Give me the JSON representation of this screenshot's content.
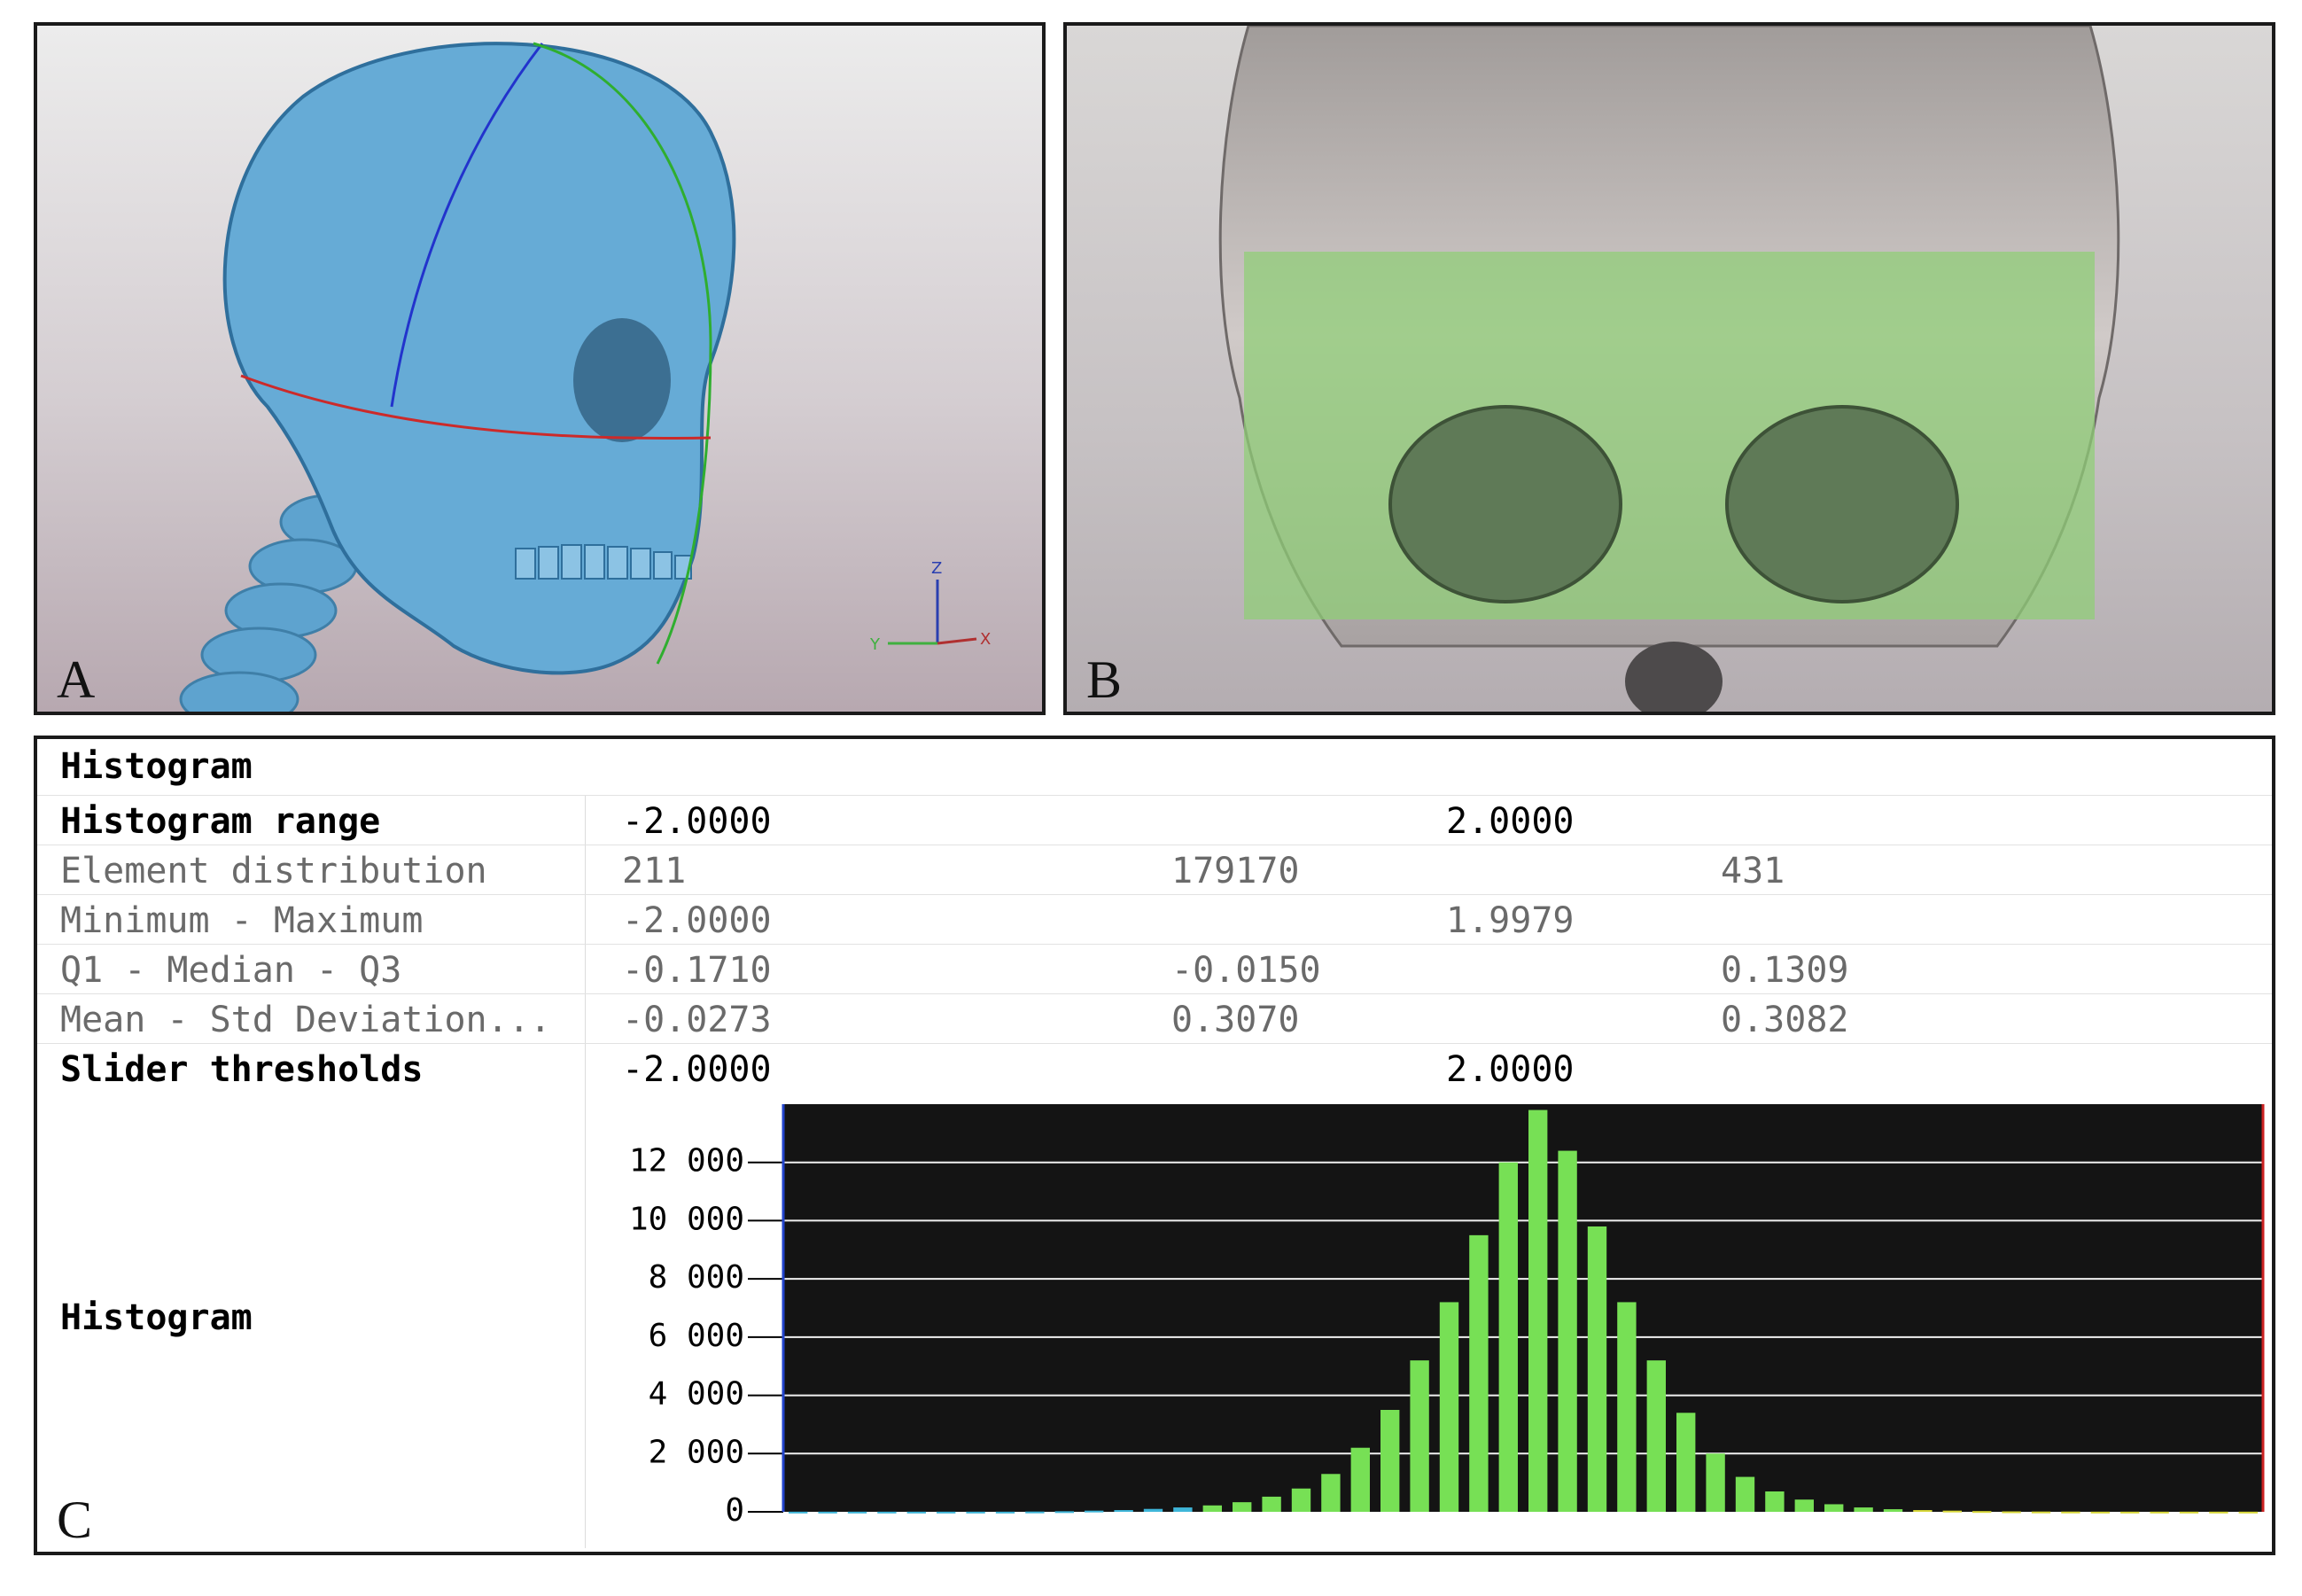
{
  "panels": {
    "a": {
      "letter": "A",
      "axes": {
        "z": "Z",
        "y": "Y",
        "x": "X"
      }
    },
    "b": {
      "letter": "B"
    },
    "c": {
      "letter": "C"
    }
  },
  "histogram_panel": {
    "title": "Histogram",
    "rows": [
      {
        "label": "Histogram range",
        "values": [
          "-2.0000",
          "",
          "2.0000",
          ""
        ],
        "strong": true
      },
      {
        "label": "Element distribution",
        "values": [
          "211",
          "179170",
          "",
          "431"
        ],
        "strong": false
      },
      {
        "label": "Minimum - Maximum",
        "values": [
          "-2.0000",
          "",
          "1.9979",
          ""
        ],
        "strong": false
      },
      {
        "label": "Q1 - Median - Q3",
        "values": [
          "-0.1710",
          "-0.0150",
          "",
          "0.1309"
        ],
        "strong": false
      },
      {
        "label": "Mean - Std Deviation...",
        "values": [
          "-0.0273",
          "0.3070",
          "",
          "0.3082"
        ],
        "strong": false
      },
      {
        "label": "Slider thresholds",
        "values": [
          "-2.0000",
          "",
          "2.0000",
          ""
        ],
        "strong": true
      }
    ],
    "histogram_label": "Histogram"
  },
  "colors": {
    "plot_bg": "#141414",
    "bar_green": "#77e055",
    "grid": "#f0f0f0",
    "skull_blue": "#62a8d4",
    "mask_green": "#9bd27f"
  },
  "chart_data": {
    "type": "bar",
    "xlim": [
      -2.0,
      2.0
    ],
    "ylim": [
      0,
      14000
    ],
    "yticks": [
      "12 000",
      "10 000",
      "8 000",
      "6 000",
      "4 000",
      "2 000",
      "0"
    ],
    "ytick_values": [
      12000,
      10000,
      8000,
      6000,
      4000,
      2000,
      0
    ],
    "bin_centers": [
      -1.96,
      -1.88,
      -1.8,
      -1.72,
      -1.64,
      -1.56,
      -1.48,
      -1.4,
      -1.32,
      -1.24,
      -1.16,
      -1.08,
      -1.0,
      -0.92,
      -0.84,
      -0.76,
      -0.68,
      -0.6,
      -0.52,
      -0.44,
      -0.36,
      -0.28,
      -0.2,
      -0.12,
      -0.04,
      0.04,
      0.12,
      0.2,
      0.28,
      0.36,
      0.44,
      0.52,
      0.6,
      0.68,
      0.76,
      0.84,
      0.92,
      1.0,
      1.08,
      1.16,
      1.24,
      1.32,
      1.4,
      1.48,
      1.56,
      1.64,
      1.72,
      1.8,
      1.88,
      1.96
    ],
    "values": [
      5,
      5,
      5,
      5,
      5,
      5,
      5,
      5,
      10,
      20,
      40,
      60,
      100,
      150,
      220,
      330,
      520,
      800,
      1300,
      2200,
      3500,
      5200,
      7200,
      9500,
      12000,
      13800,
      12400,
      9800,
      7200,
      5200,
      3400,
      2000,
      1200,
      700,
      420,
      260,
      150,
      90,
      60,
      40,
      25,
      15,
      10,
      8,
      5,
      5,
      5,
      5,
      5,
      5
    ]
  }
}
